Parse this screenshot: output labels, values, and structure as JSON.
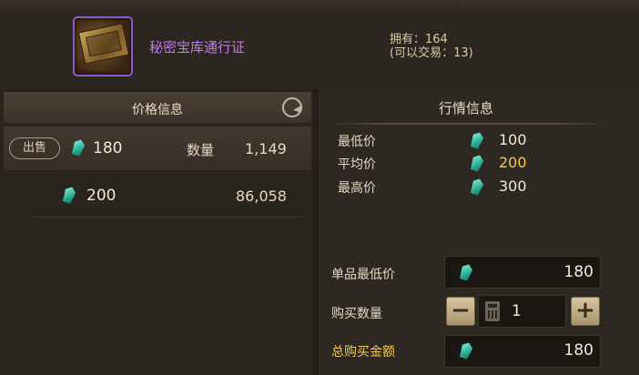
{
  "item": {
    "name": "秘密宝库通行证",
    "owned_line1": "拥有：164",
    "owned_line2": "(可以交易：13)"
  },
  "price_info": {
    "title": "价格信息",
    "sell_label": "出售",
    "qty_label": "数量",
    "rows": [
      {
        "price": "180",
        "quantity": "1,149"
      },
      {
        "price": "200",
        "quantity": "86,058"
      }
    ]
  },
  "market": {
    "title": "行情信息",
    "min_label": "最低价",
    "min_value": "100",
    "avg_label": "平均价",
    "avg_value": "200",
    "max_label": "最高价",
    "max_value": "300"
  },
  "purchase": {
    "unit_min_label": "单品最低价",
    "unit_min_value": "180",
    "qty_label": "购买数量",
    "qty_value": "1",
    "minus": "−",
    "plus": "+",
    "total_label": "总购买金额",
    "total_value": "180"
  },
  "colors": {
    "item_name": "#c07ae8",
    "highlight": "#f4c94a",
    "gem": "#2fb59a"
  }
}
